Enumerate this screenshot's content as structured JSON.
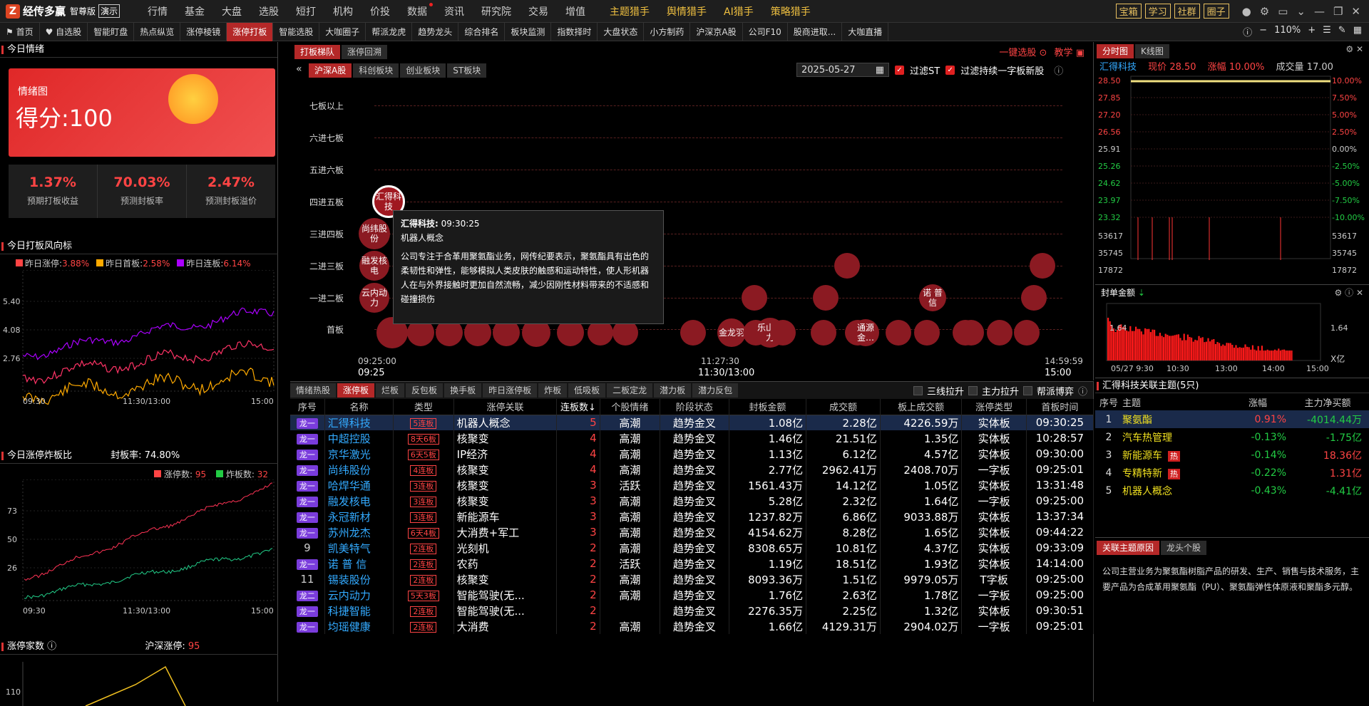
{
  "app": {
    "logo": "经传多赢",
    "edition": "智尊版",
    "demo": "演示"
  },
  "top_menu": [
    "行情",
    "基金",
    "大盘",
    "选股",
    "短打",
    "机构",
    "价投",
    "数据",
    "资讯",
    "研究院",
    "交易",
    "增值"
  ],
  "top_menu_yellow": [
    "主题猎手",
    "舆情猎手",
    "AI猎手",
    "策略猎手"
  ],
  "top_right": [
    "宝箱",
    "学习",
    "社群",
    "圈子"
  ],
  "nav": [
    "首页",
    "自选股",
    "智能盯盘",
    "热点纵览",
    "涨停棱镜",
    "涨停打板",
    "智能选股",
    "大咖圈子",
    "帮派龙虎",
    "趋势龙头",
    "综合排名",
    "板块监测",
    "指数择时",
    "大盘状态",
    "小方制药",
    "沪深京A股",
    "公司F10",
    "股商进取...",
    "大咖直播"
  ],
  "nav_active": "涨停打板",
  "zoom": "110%",
  "left": {
    "sentiment_title": "今日情绪",
    "chart_label": "情绪图",
    "score": "得分:100",
    "stats": [
      {
        "v": "1.37%",
        "l": "预期打板收益"
      },
      {
        "v": "70.03%",
        "l": "预测封板率"
      },
      {
        "v": "2.47%",
        "l": "预测封板溢价"
      }
    ],
    "wind_title": "今日打板风向标",
    "legend": [
      {
        "n": "昨日涨停:",
        "v": "3.88%",
        "c": "#ff4444"
      },
      {
        "n": "昨日首板:",
        "v": "2.58%",
        "c": "#ffaa00"
      },
      {
        "n": "昨日连板:",
        "v": "6.14%",
        "c": "#aa00ff"
      }
    ],
    "wind_y": [
      "5.40",
      "4.08",
      "2.76"
    ],
    "time_ticks": [
      "09:30",
      "11:30/13:00",
      "15:00"
    ],
    "ratio_title": "今日涨停炸板比",
    "seal_rate": "封板率: 74.80%",
    "zt_label": "涨停数:",
    "zt_val": "95",
    "zb_label": "炸板数:",
    "zb_val": "32",
    "ratio_y": [
      "73",
      "50",
      "26"
    ],
    "count_title": "涨停家数",
    "count_label": "沪深涨停:",
    "count_val": "95",
    "count_y": "110"
  },
  "ladder": {
    "tabs": [
      "打板梯队",
      "涨停回溯"
    ],
    "market_tabs": [
      "沪深A股",
      "科创板块",
      "创业板块",
      "ST板块"
    ],
    "one_key": "一键选股",
    "teach": "教学",
    "date": "2025-05-27",
    "filter_st": "过滤ST",
    "filter_new": "过滤持续一字板新股",
    "levels": [
      "七板以上",
      "六进七板",
      "五进六板",
      "四进五板",
      "三进四板",
      "二进三板",
      "一进二板",
      "首板"
    ],
    "x_ticks": [
      {
        "t1": "09:25:00",
        "t2": "09:25"
      },
      {
        "t1": "11:27:30",
        "t2": "11:30/13:00"
      },
      {
        "t1": "14:59:59",
        "t2": "15:00"
      }
    ],
    "bubbles": {
      "b1": "汇得科技",
      "b2": "尚纬股份",
      "b3": "融发核电",
      "b4": "云内动力",
      "b5": "诺 普 信",
      "b6": "金龙羽",
      "b7": "乐山电力",
      "b8": "通源金…"
    },
    "tooltip": {
      "title": "汇得科技:",
      "time": "09:30:25",
      "concept": "机器人概念",
      "desc": "公司专注于合革用聚氨酯业务，网传纪要表示，聚氨酯具有出色的柔韧性和弹性，能够模拟人类皮肤的触感和运动特性，使人形机器人在与外界接触时更加自然流畅，减少因刚性材料带来的不适感和碰撞损伤"
    }
  },
  "table": {
    "tabs": [
      "情绪热股",
      "涨停板",
      "烂板",
      "反包板",
      "换手板",
      "昨日涨停板",
      "炸板",
      "低吸板",
      "二板定龙",
      "潜力板",
      "潜力反包"
    ],
    "filters": [
      "三线拉升",
      "主力拉升",
      "帮派博弈"
    ],
    "headers": [
      "序号",
      "名称",
      "类型",
      "涨停关联",
      "连板数↓",
      "个股情绪",
      "阶段状态",
      "封板金额",
      "成交额",
      "板上成交额",
      "涨停类型",
      "首板时间"
    ],
    "rows": [
      [
        "龙一",
        "汇得科技",
        "5连板",
        "机器人概念",
        "5",
        "高潮",
        "趋势金叉",
        "1.08亿",
        "2.28亿",
        "4226.59万",
        "实体板",
        "09:30:25"
      ],
      [
        "龙一",
        "中超控股",
        "8天6板",
        "核聚变",
        "4",
        "高潮",
        "趋势金叉",
        "1.46亿",
        "21.51亿",
        "1.35亿",
        "实体板",
        "10:28:57"
      ],
      [
        "龙一",
        "京华激光",
        "6天5板",
        "IP经济",
        "4",
        "高潮",
        "趋势金叉",
        "1.13亿",
        "6.12亿",
        "4.57亿",
        "实体板",
        "09:30:00"
      ],
      [
        "龙一",
        "尚纬股份",
        "4连板",
        "核聚变",
        "4",
        "高潮",
        "趋势金叉",
        "2.77亿",
        "2962.41万",
        "2408.70万",
        "一字板",
        "09:25:01"
      ],
      [
        "龙一",
        "哈焊华通",
        "3连板",
        "核聚变",
        "3",
        "活跃",
        "趋势金叉",
        "1561.43万",
        "14.12亿",
        "1.05亿",
        "实体板",
        "13:31:48"
      ],
      [
        "龙一",
        "融发核电",
        "3连板",
        "核聚变",
        "3",
        "高潮",
        "趋势金叉",
        "5.28亿",
        "2.32亿",
        "1.64亿",
        "一字板",
        "09:25:00"
      ],
      [
        "龙一",
        "永冠新材",
        "3连板",
        "新能源车",
        "3",
        "高潮",
        "趋势金叉",
        "1237.82万",
        "6.86亿",
        "9033.88万",
        "实体板",
        "13:37:34"
      ],
      [
        "龙一",
        "苏州龙杰",
        "6天4板",
        "大消费+军工",
        "3",
        "高潮",
        "趋势金叉",
        "4154.62万",
        "8.28亿",
        "1.65亿",
        "实体板",
        "09:44:22"
      ],
      [
        "9",
        "凯美特气",
        "2连板",
        "光刻机",
        "2",
        "高潮",
        "趋势金叉",
        "8308.65万",
        "10.81亿",
        "4.37亿",
        "实体板",
        "09:33:09"
      ],
      [
        "龙一",
        "诺 普 信",
        "2连板",
        "农药",
        "2",
        "活跃",
        "趋势金叉",
        "1.19亿",
        "18.51亿",
        "1.93亿",
        "实体板",
        "14:14:00"
      ],
      [
        "11",
        "锡装股份",
        "2连板",
        "核聚变",
        "2",
        "高潮",
        "趋势金叉",
        "8093.36万",
        "1.51亿",
        "9979.05万",
        "T字板",
        "09:25:00"
      ],
      [
        "龙二",
        "云内动力",
        "5天3板",
        "智能驾驶(无...",
        "2",
        "高潮",
        "趋势金叉",
        "1.76亿",
        "2.63亿",
        "1.78亿",
        "一字板",
        "09:25:00"
      ],
      [
        "龙一",
        "科捷智能",
        "2连板",
        "智能驾驶(无...",
        "2",
        "",
        "趋势金叉",
        "2276.35万",
        "2.25亿",
        "1.32亿",
        "实体板",
        "09:30:51"
      ],
      [
        "龙一",
        "均瑶健康",
        "2连板",
        "大消费",
        "2",
        "高潮",
        "趋势金叉",
        "1.66亿",
        "4129.31万",
        "2904.02万",
        "一字板",
        "09:25:01"
      ]
    ]
  },
  "right": {
    "tabs": [
      "分时图",
      "K线图"
    ],
    "stock": "汇得科技",
    "price_label": "现价",
    "price": "28.50",
    "chg_label": "涨幅",
    "chg": "10.00%",
    "vol_label": "成交量",
    "vol": "17.00",
    "y_left": [
      "28.50",
      "27.85",
      "27.20",
      "26.56",
      "25.91",
      "25.26",
      "24.62",
      "23.97",
      "23.32"
    ],
    "y_right": [
      "10.00%",
      "7.50%",
      "5.00%",
      "2.50%",
      "0.00%",
      "-2.50%",
      "-5.00%",
      "-7.50%",
      "-10.00%"
    ],
    "vol_y": [
      "53617",
      "35745",
      "17872"
    ],
    "seal_title": "封单金额",
    "seal_y": "1.64",
    "seal_unit": "X亿",
    "seal_x": [
      "05/27 9:30",
      "10:30",
      "13:00",
      "14:00",
      "15:00"
    ],
    "theme_title": "汇得科技关联主题(5只)",
    "theme_headers": [
      "序号",
      "主题",
      "涨幅",
      "主力净买额"
    ],
    "themes": [
      [
        "1",
        "聚氨酯",
        "",
        "0.91%",
        "-4014.44万"
      ],
      [
        "2",
        "汽车热管理",
        "",
        "-0.13%",
        "-1.75亿"
      ],
      [
        "3",
        "新能源车",
        "热",
        "-0.14%",
        "18.36亿"
      ],
      [
        "4",
        "专精特新",
        "热",
        "-0.22%",
        "1.31亿"
      ],
      [
        "5",
        "机器人概念",
        "",
        "-0.43%",
        "-4.41亿"
      ]
    ],
    "reason_tabs": [
      "关联主题原因",
      "龙头个股"
    ],
    "reason": "公司主营业务为聚氨酯树脂产品的研发、生产、销售与技术服务，主要产品为合成革用聚氨酯（PU）、聚氨酯弹性体原液和聚酯多元醇。"
  }
}
